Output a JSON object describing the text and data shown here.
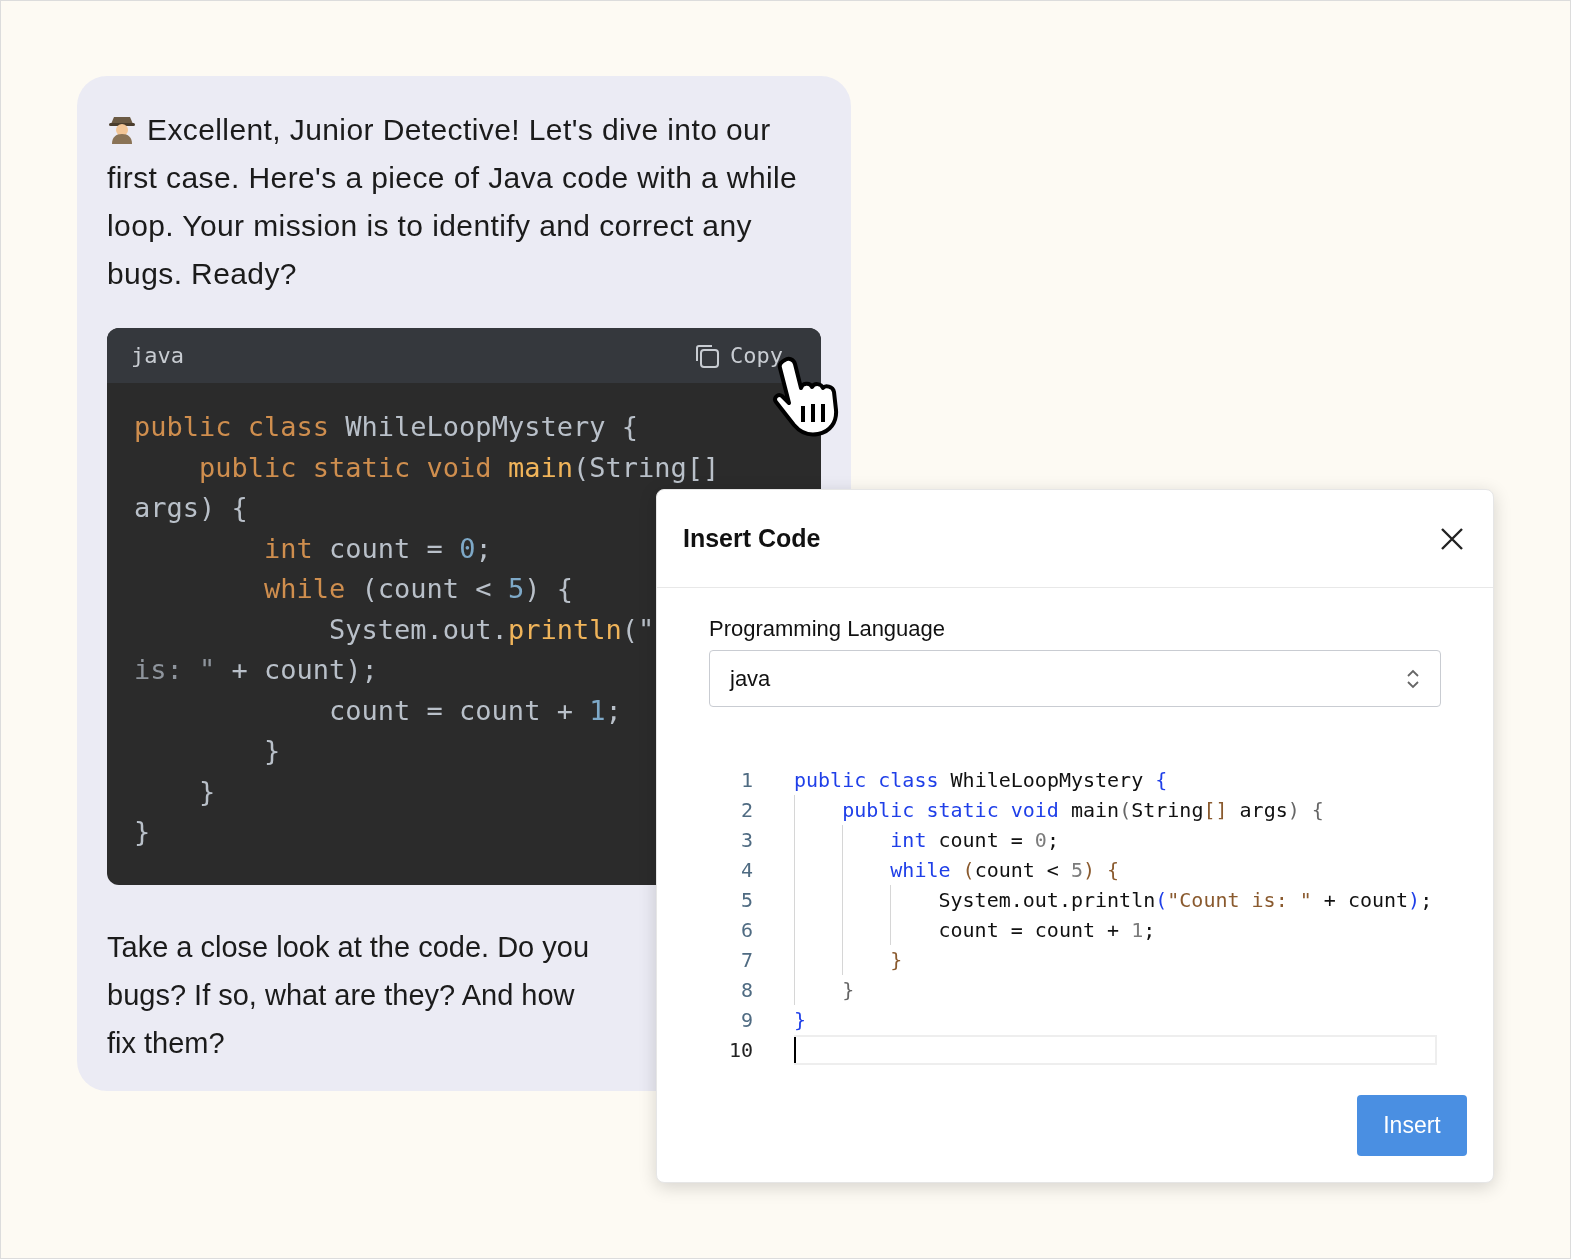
{
  "message": {
    "intro": "Excellent, Junior Detective! Let's dive into our first case. Here's a piece of Java code with a while loop. Your mission is to identify and correct any bugs. Ready?",
    "code_block": {
      "language": "java",
      "copy_label": "Copy",
      "lines": [
        [
          {
            "kind": "kw",
            "text": "public class "
          },
          {
            "kind": "plain",
            "text": "WhileLoopMystery {"
          }
        ],
        [
          {
            "kind": "kw",
            "text": "    public static void "
          },
          {
            "kind": "fn",
            "text": "main"
          },
          {
            "kind": "plain",
            "text": "(String[]"
          }
        ],
        [
          {
            "kind": "plain",
            "text": "args) {"
          }
        ],
        [
          {
            "kind": "kw",
            "text": "        int "
          },
          {
            "kind": "plain",
            "text": "count = "
          },
          {
            "kind": "num",
            "text": "0"
          },
          {
            "kind": "plain",
            "text": ";"
          }
        ],
        [
          {
            "kind": "kw",
            "text": "        while "
          },
          {
            "kind": "plain",
            "text": "(count < "
          },
          {
            "kind": "num",
            "text": "5"
          },
          {
            "kind": "plain",
            "text": ") {"
          }
        ],
        [
          {
            "kind": "plain",
            "text": "            System.out."
          },
          {
            "kind": "fn",
            "text": "println"
          },
          {
            "kind": "plain",
            "text": "(\""
          }
        ],
        [
          {
            "kind": "str",
            "text": "is: \""
          },
          {
            "kind": "plain",
            "text": " + count);"
          }
        ],
        [
          {
            "kind": "plain",
            "text": "            count = count + "
          },
          {
            "kind": "num",
            "text": "1"
          },
          {
            "kind": "plain",
            "text": ";"
          }
        ],
        [
          {
            "kind": "plain",
            "text": "        }"
          }
        ],
        [
          {
            "kind": "plain",
            "text": "    }"
          }
        ],
        [
          {
            "kind": "plain",
            "text": "}"
          }
        ]
      ]
    },
    "outro_lines": [
      "Take a close look at the code. Do you",
      "bugs? If so, what are they? And how",
      "fix them?"
    ]
  },
  "dialog": {
    "title": "Insert Code",
    "language_label": "Programming Language",
    "language_value": "java",
    "editor_lines": [
      {
        "number": "1",
        "current": false,
        "tokens": [
          {
            "kind": "kw",
            "text": "public class "
          },
          {
            "kind": "plain",
            "text": "WhileLoopMystery "
          },
          {
            "kind": "brace",
            "text": "{"
          }
        ]
      },
      {
        "number": "2",
        "current": false,
        "tokens": [
          {
            "kind": "kw",
            "text": "    public static void "
          },
          {
            "kind": "plain",
            "text": "main"
          },
          {
            "kind": "punct",
            "text": "("
          },
          {
            "kind": "plain",
            "text": "String"
          },
          {
            "kind": "str",
            "text": "[]"
          },
          {
            "kind": "plain",
            "text": " args"
          },
          {
            "kind": "punct",
            "text": ") {"
          }
        ]
      },
      {
        "number": "3",
        "current": false,
        "tokens": [
          {
            "kind": "kw",
            "text": "        int "
          },
          {
            "kind": "plain",
            "text": "count = "
          },
          {
            "kind": "num",
            "text": "0"
          },
          {
            "kind": "plain",
            "text": ";"
          }
        ]
      },
      {
        "number": "4",
        "current": false,
        "tokens": [
          {
            "kind": "kw",
            "text": "        while "
          },
          {
            "kind": "str",
            "text": "("
          },
          {
            "kind": "plain",
            "text": "count < "
          },
          {
            "kind": "num",
            "text": "5"
          },
          {
            "kind": "str",
            "text": ") {"
          }
        ]
      },
      {
        "number": "5",
        "current": false,
        "tokens": [
          {
            "kind": "plain",
            "text": "            System.out.println"
          },
          {
            "kind": "brace",
            "text": "("
          },
          {
            "kind": "str",
            "text": "\"Count is: \""
          },
          {
            "kind": "plain",
            "text": " + count"
          },
          {
            "kind": "brace",
            "text": ")"
          },
          {
            "kind": "plain",
            "text": ";"
          }
        ]
      },
      {
        "number": "6",
        "current": false,
        "tokens": [
          {
            "kind": "plain",
            "text": "            count = count + "
          },
          {
            "kind": "num",
            "text": "1"
          },
          {
            "kind": "plain",
            "text": ";"
          }
        ]
      },
      {
        "number": "7",
        "current": false,
        "tokens": [
          {
            "kind": "str",
            "text": "        }"
          }
        ]
      },
      {
        "number": "8",
        "current": false,
        "tokens": [
          {
            "kind": "punct",
            "text": "    }"
          }
        ]
      },
      {
        "number": "9",
        "current": false,
        "tokens": [
          {
            "kind": "brace",
            "text": "}"
          }
        ]
      },
      {
        "number": "10",
        "current": true
      }
    ],
    "insert_label": "Insert"
  }
}
